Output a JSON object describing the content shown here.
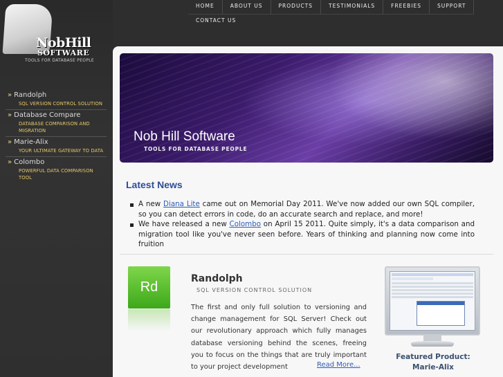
{
  "logo": {
    "word1": "NobHill",
    "word2": "SOFTWARE",
    "tagline": "TOOLS FOR DATABASE PEOPLE"
  },
  "nav": {
    "items": [
      "HOME",
      "ABOUT US",
      "PRODUCTS",
      "TESTIMONIALS",
      "FREEBIES",
      "SUPPORT"
    ],
    "contact": "CONTACT US"
  },
  "sidebar": {
    "products": [
      {
        "name": "Randolph",
        "desc": "SQL VERSION CONTROL SOLUTION"
      },
      {
        "name": "Database Compare",
        "desc": "DATABASE COMPARISON AND MIGRATION"
      },
      {
        "name": "Marie-Alix",
        "desc": "YOUR ULTIMATE GATEWAY TO DATA"
      },
      {
        "name": "Colombo",
        "desc": "POWERFUL DATA COMPARISON TOOL"
      }
    ]
  },
  "banner": {
    "title": "Nob Hill Software",
    "subtitle": "TOOLS FOR DATABASE PEOPLE"
  },
  "news": {
    "heading": "Latest News",
    "items": [
      {
        "before": "A new ",
        "link": "Diana Lite",
        "after": " came out on Memorial Day 2011. We've now added our own SQL compiler, so you can detect errors in code, do an accurate search and replace, and more!"
      },
      {
        "before": "We have released a new ",
        "link": "Colombo",
        "after": " on April 15 2011. Quite simply, it's a data comparison and migration tool like you've never seen before. Years of thinking and planning now come into fruition"
      }
    ]
  },
  "feature": {
    "icon_text": "Rd",
    "title": "Randolph",
    "subtitle": "SQL VERSION CONTROL SOLUTION",
    "description": "The first and only full solution to versioning and change management for SQL Server! Check out our revolutionary approach which fully manages database versioning behind the scenes, freeing you to focus on the things that are truly important to your project development",
    "more": "Read More..."
  },
  "featured_product": {
    "label": "Featured Product: Marie-Alix"
  },
  "colors": {
    "accent": "#2e4d98",
    "link": "#2e5cb8",
    "sidebar_sub": "#e8c86a",
    "icon_green": "#3da81a"
  }
}
